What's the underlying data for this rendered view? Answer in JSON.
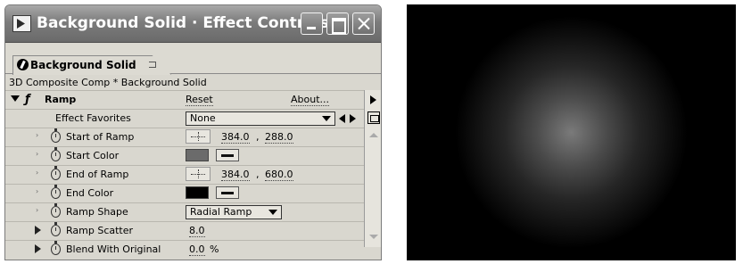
{
  "window": {
    "title": "Background Solid · Effect Controls",
    "tab_label": "Background Solid",
    "breadcrumb": "3D Composite Comp * Background Solid"
  },
  "effect": {
    "name": "Ramp",
    "reset_label": "Reset",
    "about_label": "About...",
    "favorites_label": "Effect Favorites",
    "favorites_value": "None"
  },
  "params": {
    "start_of_ramp": {
      "label": "Start of Ramp",
      "x": "384.0",
      "sep": ",",
      "y": "288.0"
    },
    "start_color": {
      "label": "Start Color",
      "swatch": "#6b6b6b"
    },
    "end_of_ramp": {
      "label": "End of Ramp",
      "x": "384.0",
      "sep": ",",
      "y": "680.0"
    },
    "end_color": {
      "label": "End Color",
      "swatch": "#000000"
    },
    "ramp_shape": {
      "label": "Ramp Shape",
      "value": "Radial Ramp"
    },
    "ramp_scatter": {
      "label": "Ramp Scatter",
      "value": "8.0"
    },
    "blend": {
      "label": "Blend With Original",
      "value": "0.0",
      "unit": "%"
    }
  },
  "colors": {
    "panel_bg": "#d9d7cf",
    "titlebar": "#7c7c7c",
    "preview_bg": "#000000"
  }
}
